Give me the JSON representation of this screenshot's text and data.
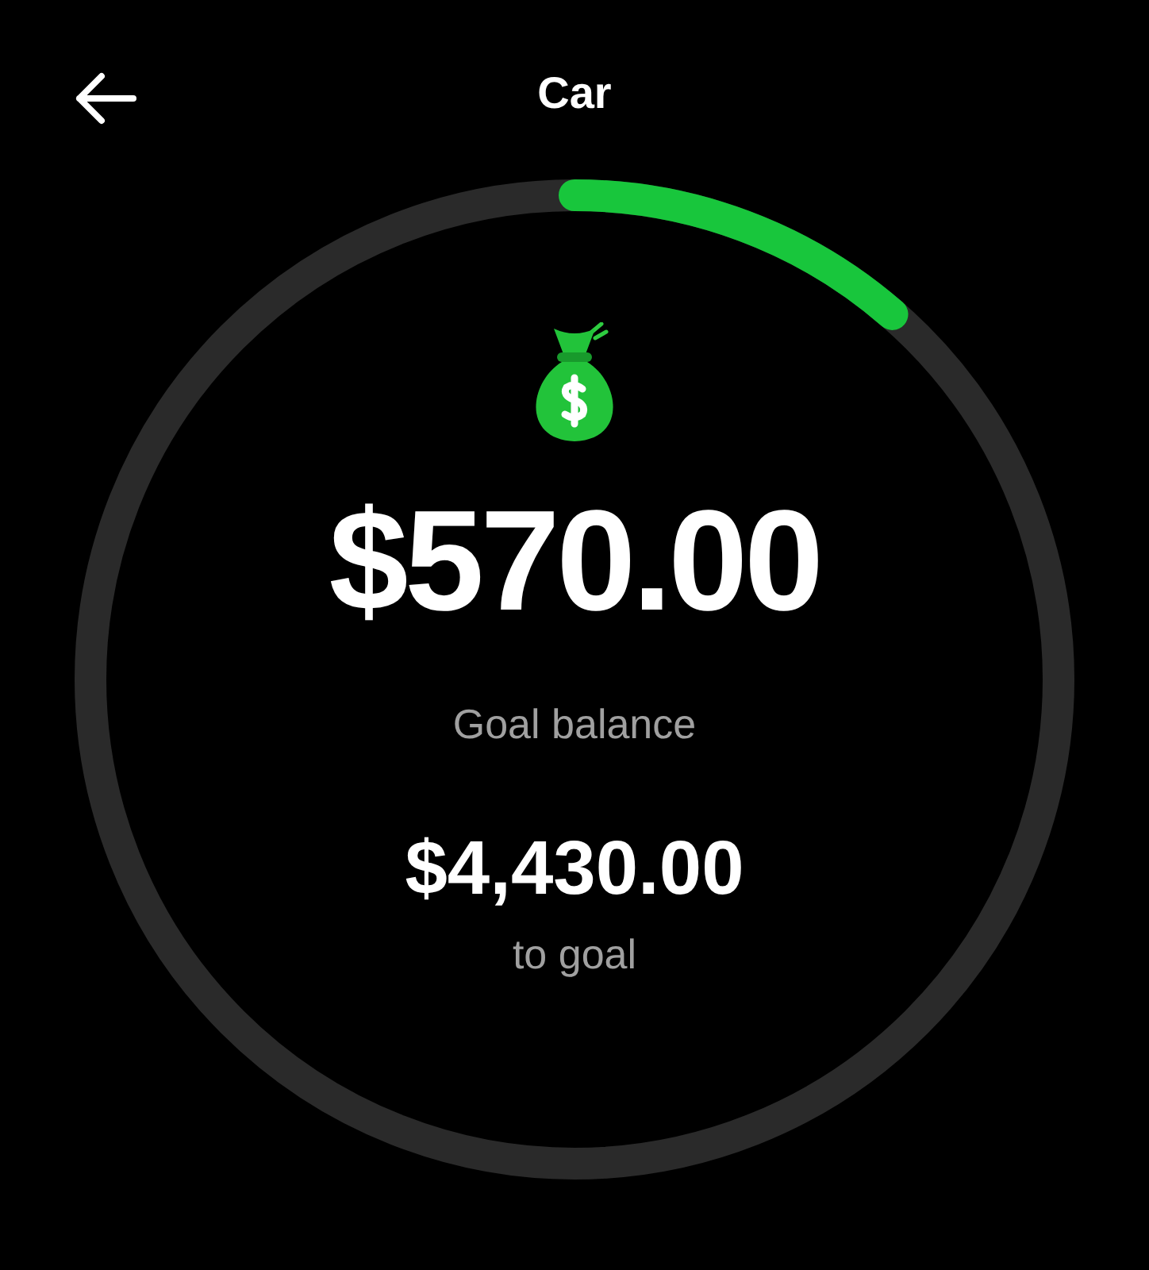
{
  "header": {
    "title": "Car"
  },
  "goal": {
    "balance": "$570.00",
    "balance_label": "Goal balance",
    "remaining": "$4,430.00",
    "remaining_label": "to goal"
  }
}
